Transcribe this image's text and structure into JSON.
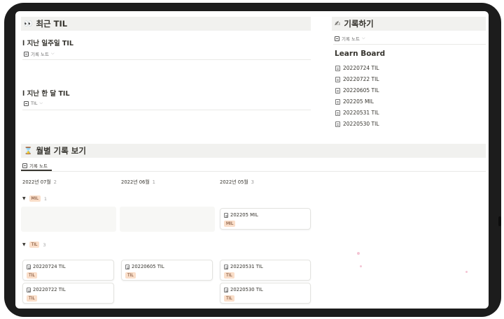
{
  "recent": {
    "icon": "eyes-emoji",
    "title": "최근 TIL",
    "last_week": {
      "title": "l 지난 일주일 TIL",
      "view": "기록 노트"
    },
    "last_month": {
      "title": "l 지난 한 달 TIL",
      "view": "TIL"
    }
  },
  "write": {
    "icon": "writing-hand-emoji",
    "title": "기록하기",
    "view": "기록 노트",
    "board_title": "Learn Board",
    "items": [
      "20220724 TIL",
      "20220722 TIL",
      "20220605 TIL",
      "202205 MIL",
      "20220531 TIL",
      "20220530 TIL"
    ]
  },
  "monthly": {
    "icon": "hourglass-emoji",
    "title": "월별 기록 보기",
    "view": "기록 노트",
    "columns": [
      {
        "label": "2022년 07월",
        "count": "2"
      },
      {
        "label": "2022년 06월",
        "count": "1"
      },
      {
        "label": "2022년 05월",
        "count": "3"
      }
    ],
    "groups": [
      {
        "tag": "MIL",
        "count": "1",
        "cards": [
          {
            "title": "202205 MIL",
            "tag": "MIL"
          }
        ]
      },
      {
        "tag": "TIL",
        "count": "3",
        "cards": [
          {
            "title": "20220724 TIL",
            "tag": "TIL"
          },
          {
            "title": "20220605 TIL",
            "tag": "TIL"
          },
          {
            "title": "20220531 TIL",
            "tag": "TIL"
          },
          {
            "title": "20220722 TIL",
            "tag": "TIL"
          },
          {
            "title": "20220530 TIL",
            "tag": "TIL"
          }
        ]
      }
    ]
  },
  "colors": {
    "header_bg": "#f1f1ef",
    "tag_bg": "#fadec9",
    "frame": "#1c1c1c"
  }
}
